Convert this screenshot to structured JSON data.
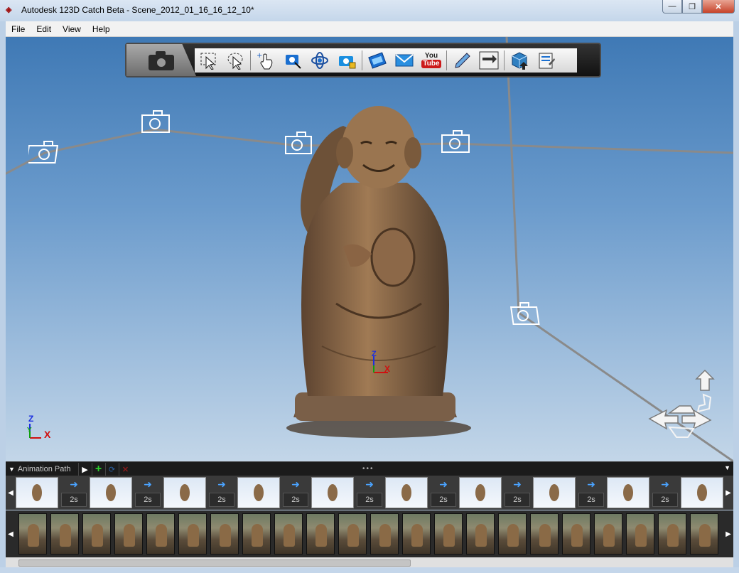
{
  "window": {
    "title": "Autodesk 123D Catch Beta - Scene_2012_01_16_16_12_10*",
    "controls": [
      "minimize",
      "maximize",
      "close"
    ]
  },
  "menu": [
    "File",
    "Edit",
    "View",
    "Help"
  ],
  "toolbar": {
    "tools": [
      {
        "name": "select-icon"
      },
      {
        "name": "lasso-select-icon"
      },
      {
        "name": "add-point-icon"
      },
      {
        "name": "pan-icon"
      },
      {
        "name": "orbit-icon"
      },
      {
        "name": "camera-lock-icon"
      },
      {
        "name": "video-icon"
      },
      {
        "name": "email-icon"
      },
      {
        "name": "youtube-icon"
      },
      {
        "name": "measure-icon"
      },
      {
        "name": "reference-icon"
      },
      {
        "name": "export-mesh-icon"
      },
      {
        "name": "properties-icon"
      }
    ],
    "youtube_top": "You",
    "youtube_bottom": "Tube"
  },
  "axes": {
    "z": "Z",
    "y": "Y",
    "x": "X"
  },
  "animation": {
    "label": "Animation Path",
    "keyframe_count": 10,
    "durations": [
      "2s",
      "2s",
      "2s",
      "2s",
      "2s",
      "2s",
      "2s",
      "2s",
      "2s"
    ]
  },
  "photos": {
    "count": 22
  },
  "colors": {
    "sky_top": "#3f79b5",
    "sky_bottom": "#c3d6e8",
    "path_line": "#8a8a8a",
    "dark_panel": "#1b1b1b"
  }
}
